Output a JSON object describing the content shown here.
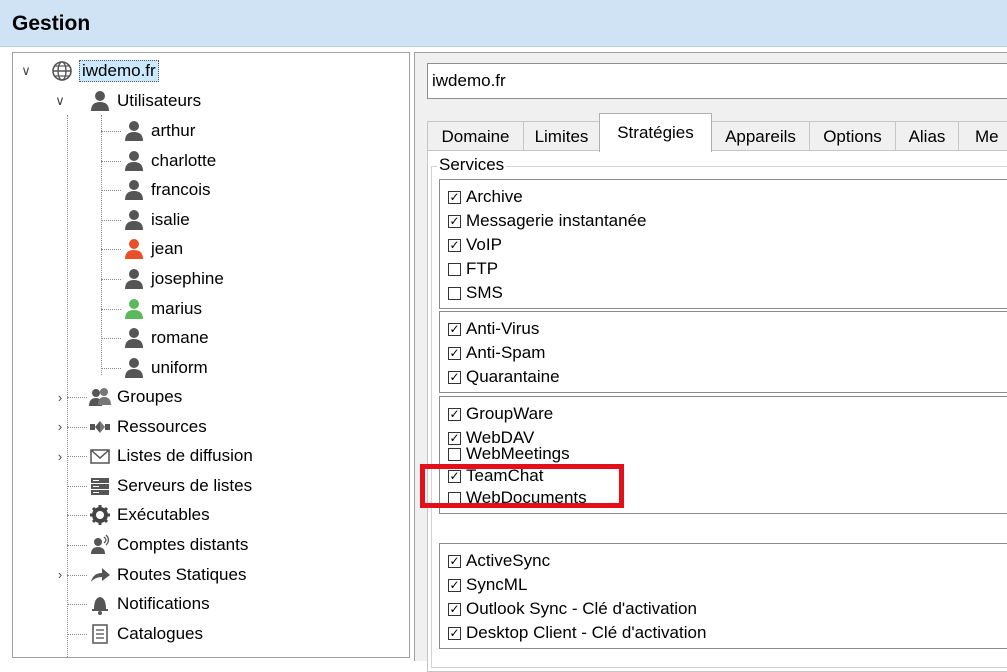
{
  "window": {
    "title": "Gestion"
  },
  "tree": {
    "root": "iwdemo.fr",
    "users_label": "Utilisateurs",
    "users": [
      {
        "name": "arthur",
        "color": "#555555"
      },
      {
        "name": "charlotte",
        "color": "#555555"
      },
      {
        "name": "francois",
        "color": "#555555"
      },
      {
        "name": "isalie",
        "color": "#555555"
      },
      {
        "name": "jean",
        "color": "#e8502a"
      },
      {
        "name": "josephine",
        "color": "#555555"
      },
      {
        "name": "marius",
        "color": "#5cb85c"
      },
      {
        "name": "romane",
        "color": "#555555"
      },
      {
        "name": "uniform",
        "color": "#555555"
      }
    ],
    "items": [
      {
        "label": "Groupes",
        "icon": "group-icon",
        "expandable": true
      },
      {
        "label": "Ressources",
        "icon": "resources-icon",
        "expandable": true
      },
      {
        "label": "Listes de diffusion",
        "icon": "mail-list-icon",
        "expandable": true
      },
      {
        "label": "Serveurs de listes",
        "icon": "list-server-icon",
        "expandable": false
      },
      {
        "label": "Exécutables",
        "icon": "gear-icon",
        "expandable": false
      },
      {
        "label": "Comptes distants",
        "icon": "remote-account-icon",
        "expandable": false
      },
      {
        "label": "Routes Statiques",
        "icon": "route-arrow-icon",
        "expandable": true
      },
      {
        "label": "Notifications",
        "icon": "bell-icon",
        "expandable": false
      },
      {
        "label": "Catalogues",
        "icon": "catalog-icon",
        "expandable": false
      }
    ]
  },
  "domain_field": {
    "value": "iwdemo.fr"
  },
  "tabs": [
    "Domaine",
    "Limites",
    "Stratégies",
    "Appareils",
    "Options",
    "Alias",
    "Me"
  ],
  "active_tab": "Stratégies",
  "services": {
    "legend": "Services",
    "groups": [
      [
        {
          "label": "Archive",
          "checked": true
        },
        {
          "label": "Messagerie instantanée",
          "checked": true
        },
        {
          "label": "VoIP",
          "checked": true
        },
        {
          "label": "FTP",
          "checked": false
        },
        {
          "label": "SMS",
          "checked": false
        }
      ],
      [
        {
          "label": "Anti-Virus",
          "checked": true
        },
        {
          "label": "Anti-Spam",
          "checked": true
        },
        {
          "label": "Quarantaine",
          "checked": true
        }
      ],
      [
        {
          "label": "GroupWare",
          "checked": true
        },
        {
          "label": "WebDAV",
          "checked": true
        },
        {
          "label": "WebMeetings",
          "checked": false
        },
        {
          "label": "TeamChat",
          "checked": true
        },
        {
          "label": "WebDocuments",
          "checked": false
        }
      ],
      [
        {
          "label": "ActiveSync",
          "checked": true
        },
        {
          "label": "SyncML",
          "checked": true
        },
        {
          "label": "Outlook Sync - Clé d'activation",
          "checked": true
        },
        {
          "label": "Desktop Client -  Clé d'activation",
          "checked": true
        }
      ]
    ]
  },
  "colors": {
    "highlight": "#e3101b",
    "selection": "#cce8ff",
    "title_bar": "#cfe3f5"
  }
}
